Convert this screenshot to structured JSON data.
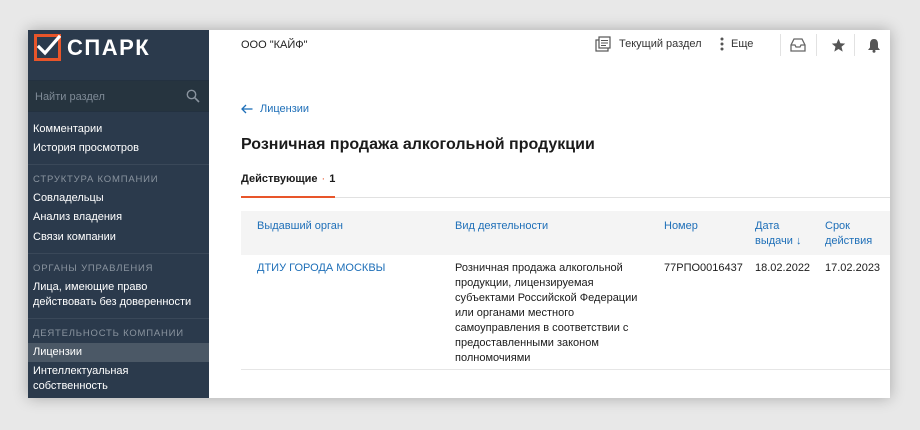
{
  "app": {
    "logo_text": "СПАРК",
    "brand_color": "#e8552a"
  },
  "sidebar": {
    "search_placeholder": "Найти раздел",
    "items_top": [
      {
        "label": "Комментарии"
      },
      {
        "label": "История просмотров"
      }
    ],
    "sections": [
      {
        "title": "СТРУКТУРА КОМПАНИИ",
        "items": [
          {
            "label": "Совладельцы"
          },
          {
            "label": "Анализ владения"
          },
          {
            "label": "Связи компании"
          }
        ]
      },
      {
        "title": "ОРГАНЫ УПРАВЛЕНИЯ",
        "items": [
          {
            "label_line1": "Лица, имеющие право",
            "label_line2": "действовать без доверенности"
          }
        ]
      },
      {
        "title": "ДЕЯТЕЛЬНОСТЬ КОМПАНИИ",
        "items": [
          {
            "label": "Лицензии",
            "active": true
          },
          {
            "label_line1": "Интеллектуальная",
            "label_line2": "собственность"
          }
        ]
      }
    ]
  },
  "topbar": {
    "company_name": "ООО \"КАЙФ\"",
    "current_section_label": "Текущий раздел",
    "more_label": "Еще"
  },
  "main": {
    "breadcrumb": "Лицензии",
    "title": "Розничная продажа алкогольной продукции",
    "tab": {
      "label": "Действующие",
      "count": "1"
    },
    "table": {
      "columns": [
        {
          "label": "Выдавший орган"
        },
        {
          "label": "Вид деятельности"
        },
        {
          "label": "Номер"
        },
        {
          "label_line1": "Дата",
          "label_line2": "выдачи ↓"
        },
        {
          "label_line1": "Срок",
          "label_line2": "действия"
        }
      ],
      "rows": [
        {
          "issuer": "ДТИУ ГОРОДА МОСКВЫ",
          "activity_lines": [
            "Розничная продажа алкогольной",
            "продукции, лицензируемая",
            "субъектами Российской Федерации",
            "или органами местного",
            "самоуправления в соответствии с",
            "предоставленными законом",
            "полномочиями"
          ],
          "number": "77РПО0016437",
          "issue_date": "18.02.2022",
          "valid_until": "17.02.2023"
        }
      ]
    }
  }
}
